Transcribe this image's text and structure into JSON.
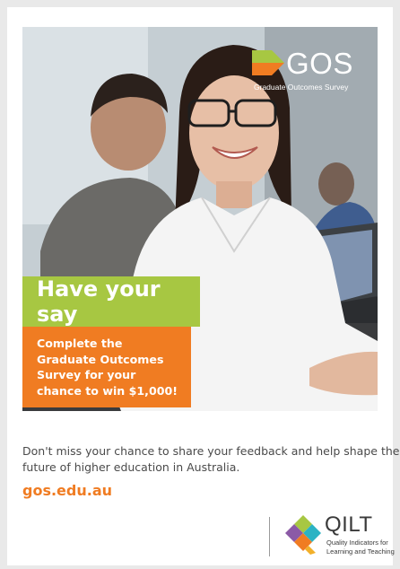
{
  "gos_logo": {
    "wordmark": "GOS",
    "tagline": "Graduate Outcomes Survey"
  },
  "hero": {
    "headline": "Have your say",
    "offer_lines": [
      "Complete the",
      "Graduate Outcomes",
      "Survey for your",
      "chance to win $1,000!"
    ]
  },
  "body": {
    "lines": [
      "Don't miss your chance to share your feedback and help shape the",
      "future of higher education in Australia."
    ],
    "link": "gos.edu.au"
  },
  "qilt_logo": {
    "wordmark": "QILT",
    "tagline_lines": [
      "Quality Indicators for",
      "Learning and Teaching"
    ]
  },
  "colors": {
    "green": "#a7c742",
    "orange": "#f07c22",
    "body_text": "#4a4a4a"
  }
}
